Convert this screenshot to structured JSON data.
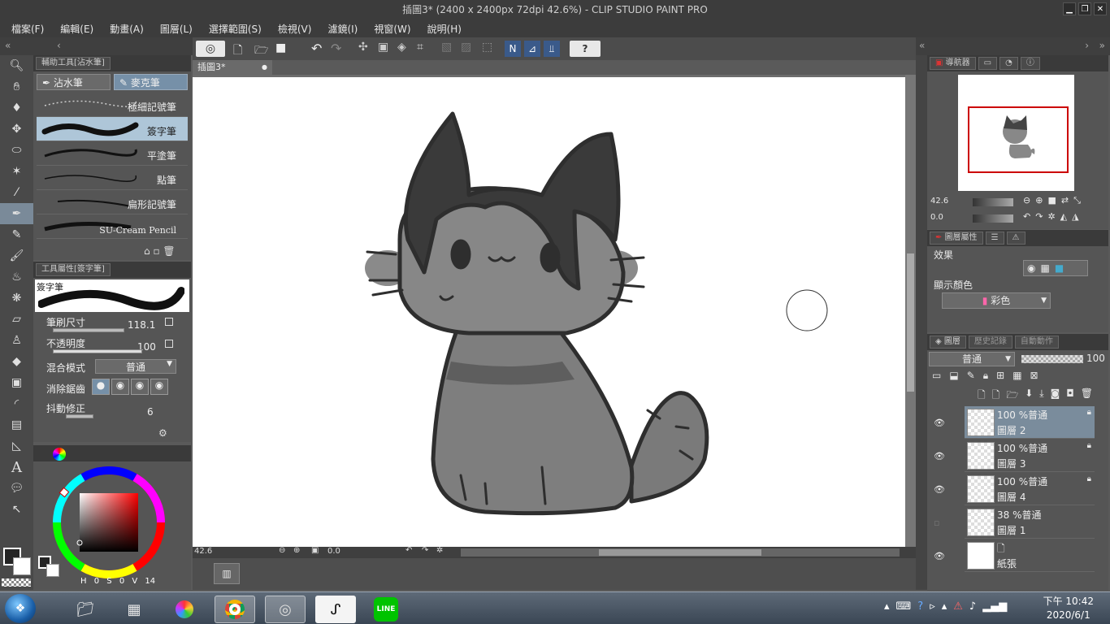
{
  "window_title": "插圖3* (2400 x 2400px 72dpi 42.6%)  - CLIP STUDIO PAINT PRO",
  "menu": [
    "檔案(F)",
    "編輯(E)",
    "動畫(A)",
    "圖層(L)",
    "選擇範圍(S)",
    "檢視(V)",
    "濾鏡(I)",
    "視窗(W)",
    "說明(H)"
  ],
  "subtool_panel": {
    "title": "輔助工具[沾水筆]",
    "tabs": [
      "沾水筆",
      "麥克筆"
    ],
    "brushes": [
      "極細記號筆",
      "簽字筆",
      "平塗筆",
      "點筆",
      "扁形記號筆",
      "SU-Cream Pencil"
    ]
  },
  "tool_property": {
    "title": "工具屬性[簽字筆]",
    "preset_name": "簽字筆",
    "brush_size_label": "筆刷尺寸",
    "brush_size_value": "118.1",
    "opacity_label": "不透明度",
    "opacity_value": "100",
    "blend_label": "混合模式",
    "blend_value": "普通",
    "antialias_label": "消除鋸齒",
    "stabilization_label": "抖動修正",
    "stabilization_value": "6"
  },
  "color_readout": {
    "h_label": "H",
    "h": "0",
    "s_label": "S",
    "s": "0",
    "v_label": "V",
    "v": "14"
  },
  "canvas": {
    "tab": "插圖3*",
    "zoom": "42.6",
    "rotation": "0.0"
  },
  "navigator": {
    "title": "導航器",
    "zoom": "42.6",
    "rotation": "0.0"
  },
  "layer_property": {
    "title": "圖層屬性",
    "effect_label": "效果",
    "display_color_label": "顯示顏色",
    "display_color_value": "彩色"
  },
  "layers_panel": {
    "tabs": [
      "圖層",
      "歷史記錄",
      "自動動作"
    ],
    "blend_mode": "普通",
    "opacity": "100",
    "layers": [
      {
        "mode": "100 %普通",
        "name": "圖層 2"
      },
      {
        "mode": "100 %普通",
        "name": "圖層 3"
      },
      {
        "mode": "100 %普通",
        "name": "圖層 4"
      },
      {
        "mode": "38 %普通",
        "name": "圖層 1"
      },
      {
        "mode": "",
        "name": "紙張"
      }
    ]
  },
  "taskbar": {
    "time": "下午 10:42",
    "date": "2020/6/1",
    "line_label": "LINE"
  },
  "colors": {
    "accent": "#7a8c9c",
    "selection_blue": "#7690a8",
    "navigator_frame": "#cc0000"
  }
}
